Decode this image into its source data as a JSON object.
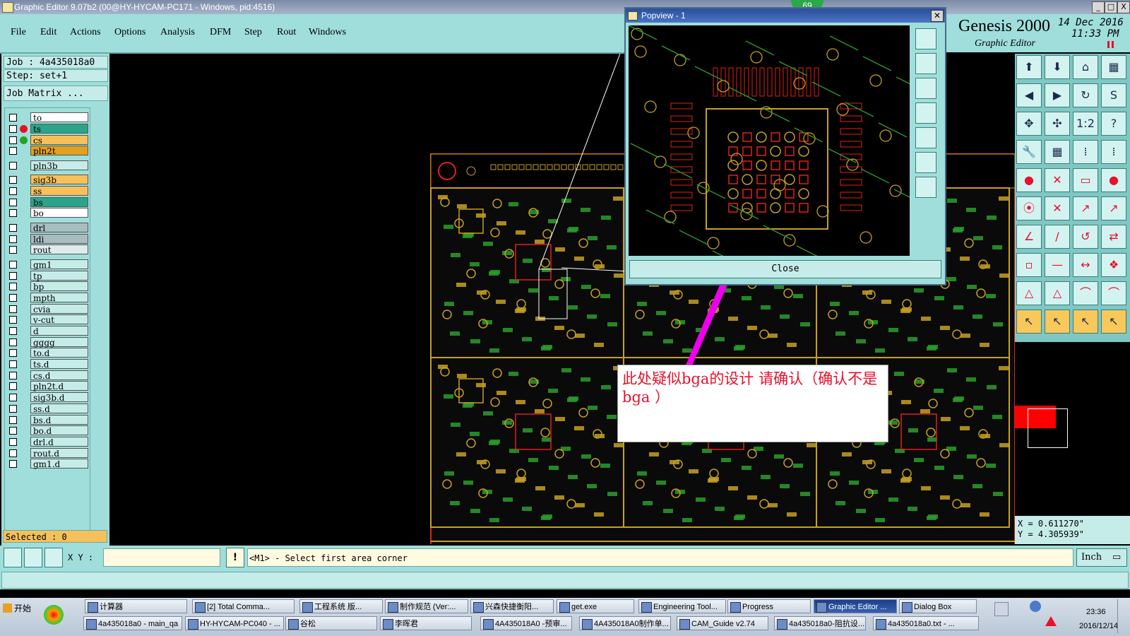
{
  "window": {
    "title": "Graphic Editor 9.07b2 (00@HY-HYCAM-PC171 - Windows, pid:4516)",
    "buttons": [
      "_",
      "□",
      "X"
    ]
  },
  "menu": [
    "File",
    "Edit",
    "Actions",
    "Options",
    "Analysis",
    "DFM",
    "Step",
    "Rout",
    "Windows"
  ],
  "header": {
    "brand": "Genesis 2000",
    "subtitle": "Graphic Editor",
    "date": "14 Dec 2016",
    "time": "11:33 PM",
    "badge": "69"
  },
  "job": {
    "job_label": "Job : 4a435018a0",
    "step_label": "Step: set+1",
    "matrix_button": "Job Matrix ..."
  },
  "layers": [
    {
      "name": "to",
      "color": "#ffffff",
      "dot": ""
    },
    {
      "name": "ts",
      "color": "#2aa58a",
      "dot": "#e8102a"
    },
    {
      "name": "cs",
      "color": "#f6c05a",
      "dot": "#28a028"
    },
    {
      "name": "pln2t",
      "color": "#e0a020",
      "dot": ""
    },
    {
      "name": "pln3b",
      "color": "#c6ece9",
      "dot": ""
    },
    {
      "name": "sig3b",
      "color": "#f6c05a",
      "dot": ""
    },
    {
      "name": "ss",
      "color": "#f6c05a",
      "dot": ""
    },
    {
      "name": "bs",
      "color": "#2aa58a",
      "dot": ""
    },
    {
      "name": "bo",
      "color": "#ffffff",
      "dot": ""
    },
    {
      "name": "drl",
      "color": "#a9bcc2",
      "dot": ""
    },
    {
      "name": "ldi",
      "color": "#a9bcc2",
      "dot": ""
    },
    {
      "name": "rout",
      "color": "#e0ecec",
      "dot": ""
    },
    {
      "name": "gm1",
      "color": "#c6ece9",
      "dot": ""
    },
    {
      "name": "tp",
      "color": "#c6ece9",
      "dot": ""
    },
    {
      "name": "bp",
      "color": "#c6ece9",
      "dot": ""
    },
    {
      "name": "mpth",
      "color": "#c6ece9",
      "dot": ""
    },
    {
      "name": "cvia",
      "color": "#c6ece9",
      "dot": ""
    },
    {
      "name": "v-cut",
      "color": "#c6ece9",
      "dot": ""
    },
    {
      "name": "d",
      "color": "#c6ece9",
      "dot": ""
    },
    {
      "name": "gggg",
      "color": "#c6ece9",
      "dot": ""
    },
    {
      "name": "to.d",
      "color": "#c6ece9",
      "dot": ""
    },
    {
      "name": "ts.d",
      "color": "#c6ece9",
      "dot": ""
    },
    {
      "name": "cs.d",
      "color": "#c6ece9",
      "dot": ""
    },
    {
      "name": "pln2t.d",
      "color": "#c6ece9",
      "dot": ""
    },
    {
      "name": "sig3b.d",
      "color": "#c6ece9",
      "dot": ""
    },
    {
      "name": "ss.d",
      "color": "#c6ece9",
      "dot": ""
    },
    {
      "name": "bs.d",
      "color": "#c6ece9",
      "dot": ""
    },
    {
      "name": "bo.d",
      "color": "#c6ece9",
      "dot": ""
    },
    {
      "name": "drl.d",
      "color": "#c6ece9",
      "dot": ""
    },
    {
      "name": "rout.d",
      "color": "#c6ece9",
      "dot": ""
    },
    {
      "name": "gm1.d",
      "color": "#c6ece9",
      "dot": ""
    }
  ],
  "selected": "Selected : 0",
  "popview": {
    "title": "Popview - 1",
    "close_label": "Close"
  },
  "annotation": "此处疑似bga的设计  请确认（确认不是bga    ）",
  "coords": {
    "x": "X = 0.611270\"",
    "y": "Y = 4.305939\""
  },
  "command": {
    "xy_label": "X Y :",
    "xy_value": "",
    "prompt": "<M1> - Select first area corner",
    "unit": "Inch"
  },
  "taskbar": {
    "start": "开始",
    "row1": [
      "计算器",
      "[2] Total Comma...",
      "工程系统  版...",
      "制作规范 (Ver:...",
      "兴森快捷衡阳...",
      "get.exe",
      "Engineering Tool...",
      "Progress",
      "Graphic Editor ...",
      "Dialog Box"
    ],
    "row2": [
      "4a435018a0 - main_qa",
      "HY-HYCAM-PC040 - ...",
      "谷松",
      "李晖君",
      "4A435018A0 -预审...",
      "4A435018A0制作单...",
      "CAM_Guide v2.74",
      "4a435018a0-阻抗设...",
      "4a435018a0.txt - ..."
    ],
    "clock_time": "23:36",
    "clock_date": "2016/12/14"
  },
  "colors": {
    "panel": "#9fdedb",
    "copper": "#c8a020",
    "trace_green": "#2a9d2a",
    "pad_red": "#e0201a",
    "arrow": "#ee00ee"
  }
}
